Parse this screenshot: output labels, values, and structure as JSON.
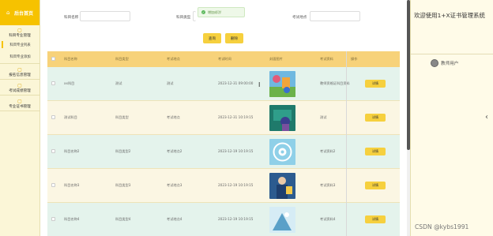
{
  "sidebar": {
    "brand": "后台首页",
    "groups": [
      {
        "title": "科目专业管理",
        "items": [
          "科目专业列表",
          "科目专业添加"
        ]
      },
      {
        "title": "报名信息管理",
        "items": []
      },
      {
        "title": "考试成绩管理",
        "items": []
      },
      {
        "title": "专业证书管理",
        "items": []
      }
    ]
  },
  "search": {
    "field1_label": "科目名称",
    "field2_label": "科目类型",
    "field3_label": "考试地点",
    "query_button": "查询",
    "delete_button": "删除"
  },
  "toast": {
    "text": "增加成功!"
  },
  "table": {
    "headers": [
      "科目名称",
      "科目类型",
      "考试地点",
      "考试时间",
      "封面图片",
      "考试资料",
      "操作"
    ],
    "detail_label": "详情",
    "rows": [
      {
        "name": "xx科目",
        "type": "测试",
        "place": "测试",
        "time": "2023-12-31 09:00:00",
        "material": "教师资格证科目资料"
      },
      {
        "name": "测试科目",
        "type": "科目类型",
        "place": "考试地点",
        "time": "2023-12-31 10:19:15",
        "material": "测试"
      },
      {
        "name": "科目名称2",
        "type": "科目类型2",
        "place": "考试地点2",
        "time": "2023-12-19 10:19:15",
        "material": "考试资料2"
      },
      {
        "name": "科目名称3",
        "type": "科目类型3",
        "place": "考试地点3",
        "time": "2023-12-19 10:19:15",
        "material": "考试资料3"
      },
      {
        "name": "科目名称4",
        "type": "科目类型4",
        "place": "考试地点4",
        "time": "2023-12-19 10:19:15",
        "material": "考试资料4"
      }
    ]
  },
  "right": {
    "welcome": "欢迎使用1+X证书管理系统",
    "user": "教师用户"
  },
  "watermark": "CSDN @kybs1991",
  "colors": {
    "accent": "#f6c200",
    "header_row": "#f7d27a",
    "alt_row": "#e4f3ec",
    "button": "#f6d03e"
  }
}
